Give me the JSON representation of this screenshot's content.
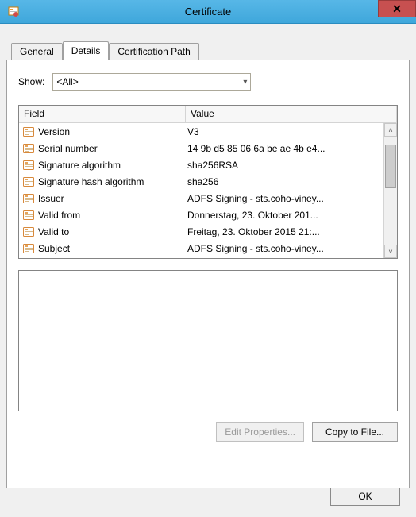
{
  "window": {
    "title": "Certificate"
  },
  "tabs": {
    "general": "General",
    "details": "Details",
    "path": "Certification Path"
  },
  "show": {
    "label": "Show:",
    "selected": "<All>"
  },
  "columns": {
    "field": "Field",
    "value": "Value"
  },
  "rows": [
    {
      "field": "Version",
      "value": "V3"
    },
    {
      "field": "Serial number",
      "value": "14 9b d5 85 06 6a be ae 4b e4..."
    },
    {
      "field": "Signature algorithm",
      "value": "sha256RSA"
    },
    {
      "field": "Signature hash algorithm",
      "value": "sha256"
    },
    {
      "field": "Issuer",
      "value": "ADFS Signing - sts.coho-viney..."
    },
    {
      "field": "Valid from",
      "value": "Donnerstag, 23. Oktober 201..."
    },
    {
      "field": "Valid to",
      "value": "Freitag, 23. Oktober 2015 21:..."
    },
    {
      "field": "Subject",
      "value": "ADFS Signing - sts.coho-viney..."
    }
  ],
  "buttons": {
    "edit": "Edit Properties...",
    "copy": "Copy to File...",
    "ok": "OK"
  }
}
